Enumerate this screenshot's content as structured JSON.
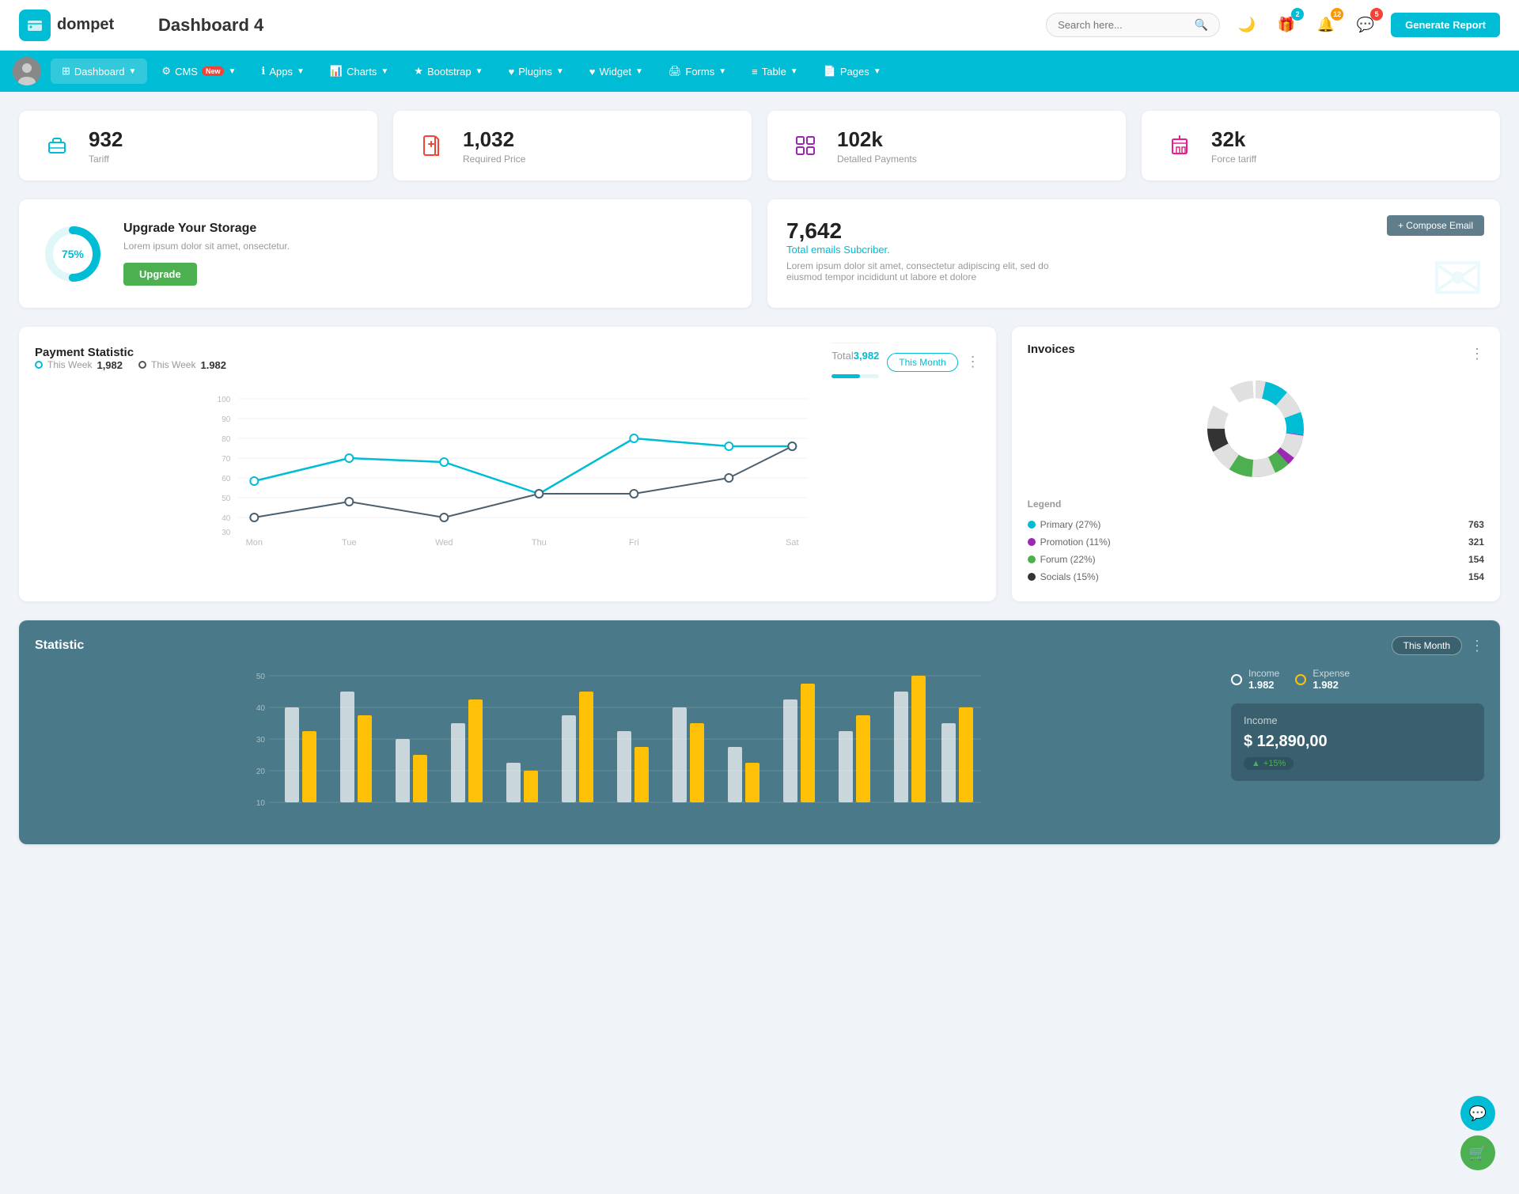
{
  "app": {
    "logo_text": "dompet",
    "title": "Dashboard 4"
  },
  "header": {
    "search_placeholder": "Search here...",
    "gift_badge": "2",
    "notif_badge": "12",
    "msg_badge": "5",
    "gen_report_label": "Generate Report"
  },
  "navbar": {
    "items": [
      {
        "id": "dashboard",
        "label": "Dashboard",
        "active": true,
        "has_arrow": true
      },
      {
        "id": "cms",
        "label": "CMS",
        "active": false,
        "has_arrow": true,
        "has_new": true
      },
      {
        "id": "apps",
        "label": "Apps",
        "active": false,
        "has_arrow": true
      },
      {
        "id": "charts",
        "label": "Charts",
        "active": false,
        "has_arrow": true
      },
      {
        "id": "bootstrap",
        "label": "Bootstrap",
        "active": false,
        "has_arrow": true
      },
      {
        "id": "plugins",
        "label": "Plugins",
        "active": false,
        "has_arrow": true
      },
      {
        "id": "widget",
        "label": "Widget",
        "active": false,
        "has_arrow": true
      },
      {
        "id": "forms",
        "label": "Forms",
        "active": false,
        "has_arrow": true
      },
      {
        "id": "table",
        "label": "Table",
        "active": false,
        "has_arrow": true
      },
      {
        "id": "pages",
        "label": "Pages",
        "active": false,
        "has_arrow": true
      }
    ]
  },
  "stat_cards": [
    {
      "id": "tariff",
      "num": "932",
      "label": "Tariff",
      "icon": "briefcase",
      "color": "teal"
    },
    {
      "id": "required_price",
      "num": "1,032",
      "label": "Required Price",
      "icon": "file-plus",
      "color": "red"
    },
    {
      "id": "detailed_payments",
      "num": "102k",
      "label": "Detalled Payments",
      "icon": "grid",
      "color": "purple"
    },
    {
      "id": "force_tariff",
      "num": "32k",
      "label": "Force tariff",
      "icon": "building",
      "color": "pink"
    }
  ],
  "upgrade": {
    "percent": "75%",
    "title": "Upgrade Your Storage",
    "desc": "Lorem ipsum dolor sit amet, onsectetur.",
    "btn_label": "Upgrade"
  },
  "email_card": {
    "num": "7,642",
    "sub_label": "Total emails Subcriber.",
    "desc": "Lorem ipsum dolor sit amet, consectetur adipiscing elit, sed do eiusmod tempor incididunt ut labore et dolore",
    "compose_label": "+ Compose Email"
  },
  "payment_statistic": {
    "title": "Payment Statistic",
    "this_month_label": "This Month",
    "legend1_label": "This Week",
    "legend1_val": "1,982",
    "legend2_label": "This Week",
    "legend2_val": "1.982",
    "total_label": "Total",
    "total_val": "3,982",
    "progress_pct": 60,
    "y_labels": [
      "100",
      "90",
      "80",
      "70",
      "60",
      "50",
      "40",
      "30"
    ],
    "x_labels": [
      "Mon",
      "Tue",
      "Wed",
      "Thu",
      "Fri",
      "Sat"
    ]
  },
  "invoices": {
    "title": "Invoices",
    "legend_title": "Legend",
    "segments": [
      {
        "label": "Primary (27%)",
        "color": "#00bcd4",
        "count": "763"
      },
      {
        "label": "Promotion (11%)",
        "color": "#9c27b0",
        "count": "321"
      },
      {
        "label": "Forum (22%)",
        "color": "#4caf50",
        "count": "154"
      },
      {
        "label": "Socials (15%)",
        "color": "#333",
        "count": "154"
      }
    ]
  },
  "statistic": {
    "title": "Statistic",
    "this_month_label": "This Month",
    "income_label": "Income",
    "income_val": "1.982",
    "expense_label": "Expense",
    "expense_val": "1.982",
    "income_detail_title": "Income",
    "income_amount": "$ 12,890,00",
    "income_badge": "+15%",
    "y_labels": [
      "50",
      "40",
      "30",
      "20",
      "10"
    ],
    "x_labels": [
      "",
      "",
      "",
      "",
      "",
      "",
      "",
      "",
      "",
      "",
      "",
      "",
      "",
      ""
    ]
  },
  "floating": {
    "chat_icon": "💬",
    "cart_icon": "🛒"
  }
}
